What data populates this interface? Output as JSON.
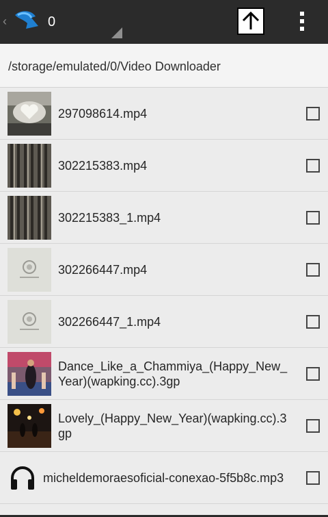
{
  "header": {
    "count": "0",
    "back_icon": "chevron-left-icon",
    "logo_icon": "download-arrow-icon",
    "up_icon": "arrow-up-icon",
    "menu_icon": "overflow-menu-icon"
  },
  "path": "/storage/emulated/0/Video Downloader",
  "files": [
    {
      "name": "297098614.mp4",
      "thumb": "video-thumbnail-heart"
    },
    {
      "name": "302215383.mp4",
      "thumb": "video-thumbnail-building"
    },
    {
      "name": "302215383_1.mp4",
      "thumb": "video-thumbnail-building"
    },
    {
      "name": "302266447.mp4",
      "thumb": "video-thumbnail-logo"
    },
    {
      "name": "302266447_1.mp4",
      "thumb": "video-thumbnail-logo"
    },
    {
      "name": "Dance_Like_a_Chammiya_(Happy_New_Year)(wapking.cc).3gp",
      "thumb": "video-thumbnail-dance"
    },
    {
      "name": "Lovely_(Happy_New_Year)(wapking.cc).3gp",
      "thumb": "video-thumbnail-stage"
    },
    {
      "name": "micheldemoraesoficial-conexao-5f5b8c.mp3",
      "thumb": "headphones-icon"
    }
  ]
}
